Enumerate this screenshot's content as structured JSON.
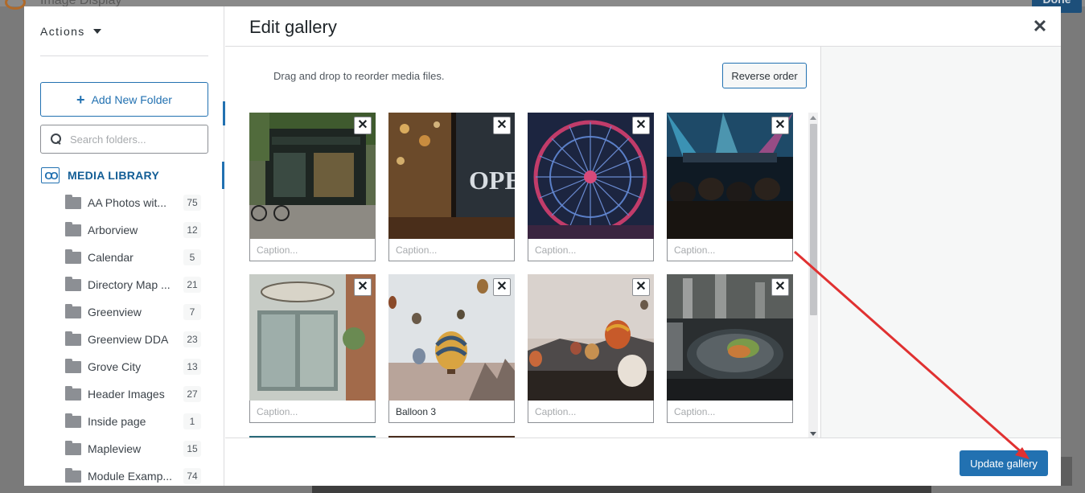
{
  "backdrop": {
    "page_title": "Image Display",
    "done_label": "Done"
  },
  "sidebar": {
    "actions_label": "Actions",
    "add_folder_label": "Add New Folder",
    "search_placeholder": "Search folders...",
    "media_library_label": "MEDIA LIBRARY",
    "folders": [
      {
        "name": "AA Photos with Captions",
        "display": "AA Photos wit...",
        "count": "75"
      },
      {
        "name": "Arborview",
        "display": "Arborview",
        "count": "12"
      },
      {
        "name": "Calendar",
        "display": "Calendar",
        "count": "5"
      },
      {
        "name": "Directory Map",
        "display": "Directory Map ...",
        "count": "21"
      },
      {
        "name": "Greenview",
        "display": "Greenview",
        "count": "7"
      },
      {
        "name": "Greenview DDA",
        "display": "Greenview DDA",
        "count": "23"
      },
      {
        "name": "Grove City",
        "display": "Grove City",
        "count": "13"
      },
      {
        "name": "Header Images",
        "display": "Header Images",
        "count": "27"
      },
      {
        "name": "Inside page",
        "display": "Inside page",
        "count": "1"
      },
      {
        "name": "Mapleview",
        "display": "Mapleview",
        "count": "15"
      },
      {
        "name": "Module Examples",
        "display": "Module Examp...",
        "count": "74"
      }
    ]
  },
  "dialog": {
    "title": "Edit gallery",
    "instructions": "Drag and drop to reorder media files.",
    "reverse_order_label": "Reverse order",
    "update_label": "Update gallery",
    "caption_placeholder": "Caption...",
    "remove_glyph": "✕",
    "close_glyph": "✕",
    "images": [
      {
        "subject": "bakery storefront",
        "caption": ""
      },
      {
        "subject": "open sign window",
        "caption": ""
      },
      {
        "subject": "ferris wheel",
        "caption": ""
      },
      {
        "subject": "concert crowd",
        "caption": ""
      },
      {
        "subject": "shop window",
        "caption": ""
      },
      {
        "subject": "hot air balloons",
        "caption": "Balloon 3"
      },
      {
        "subject": "balloons over valley",
        "caption": ""
      },
      {
        "subject": "plated dinner",
        "caption": ""
      }
    ]
  },
  "colors": {
    "accent": "#2271b1",
    "annotation": "#e03131"
  }
}
